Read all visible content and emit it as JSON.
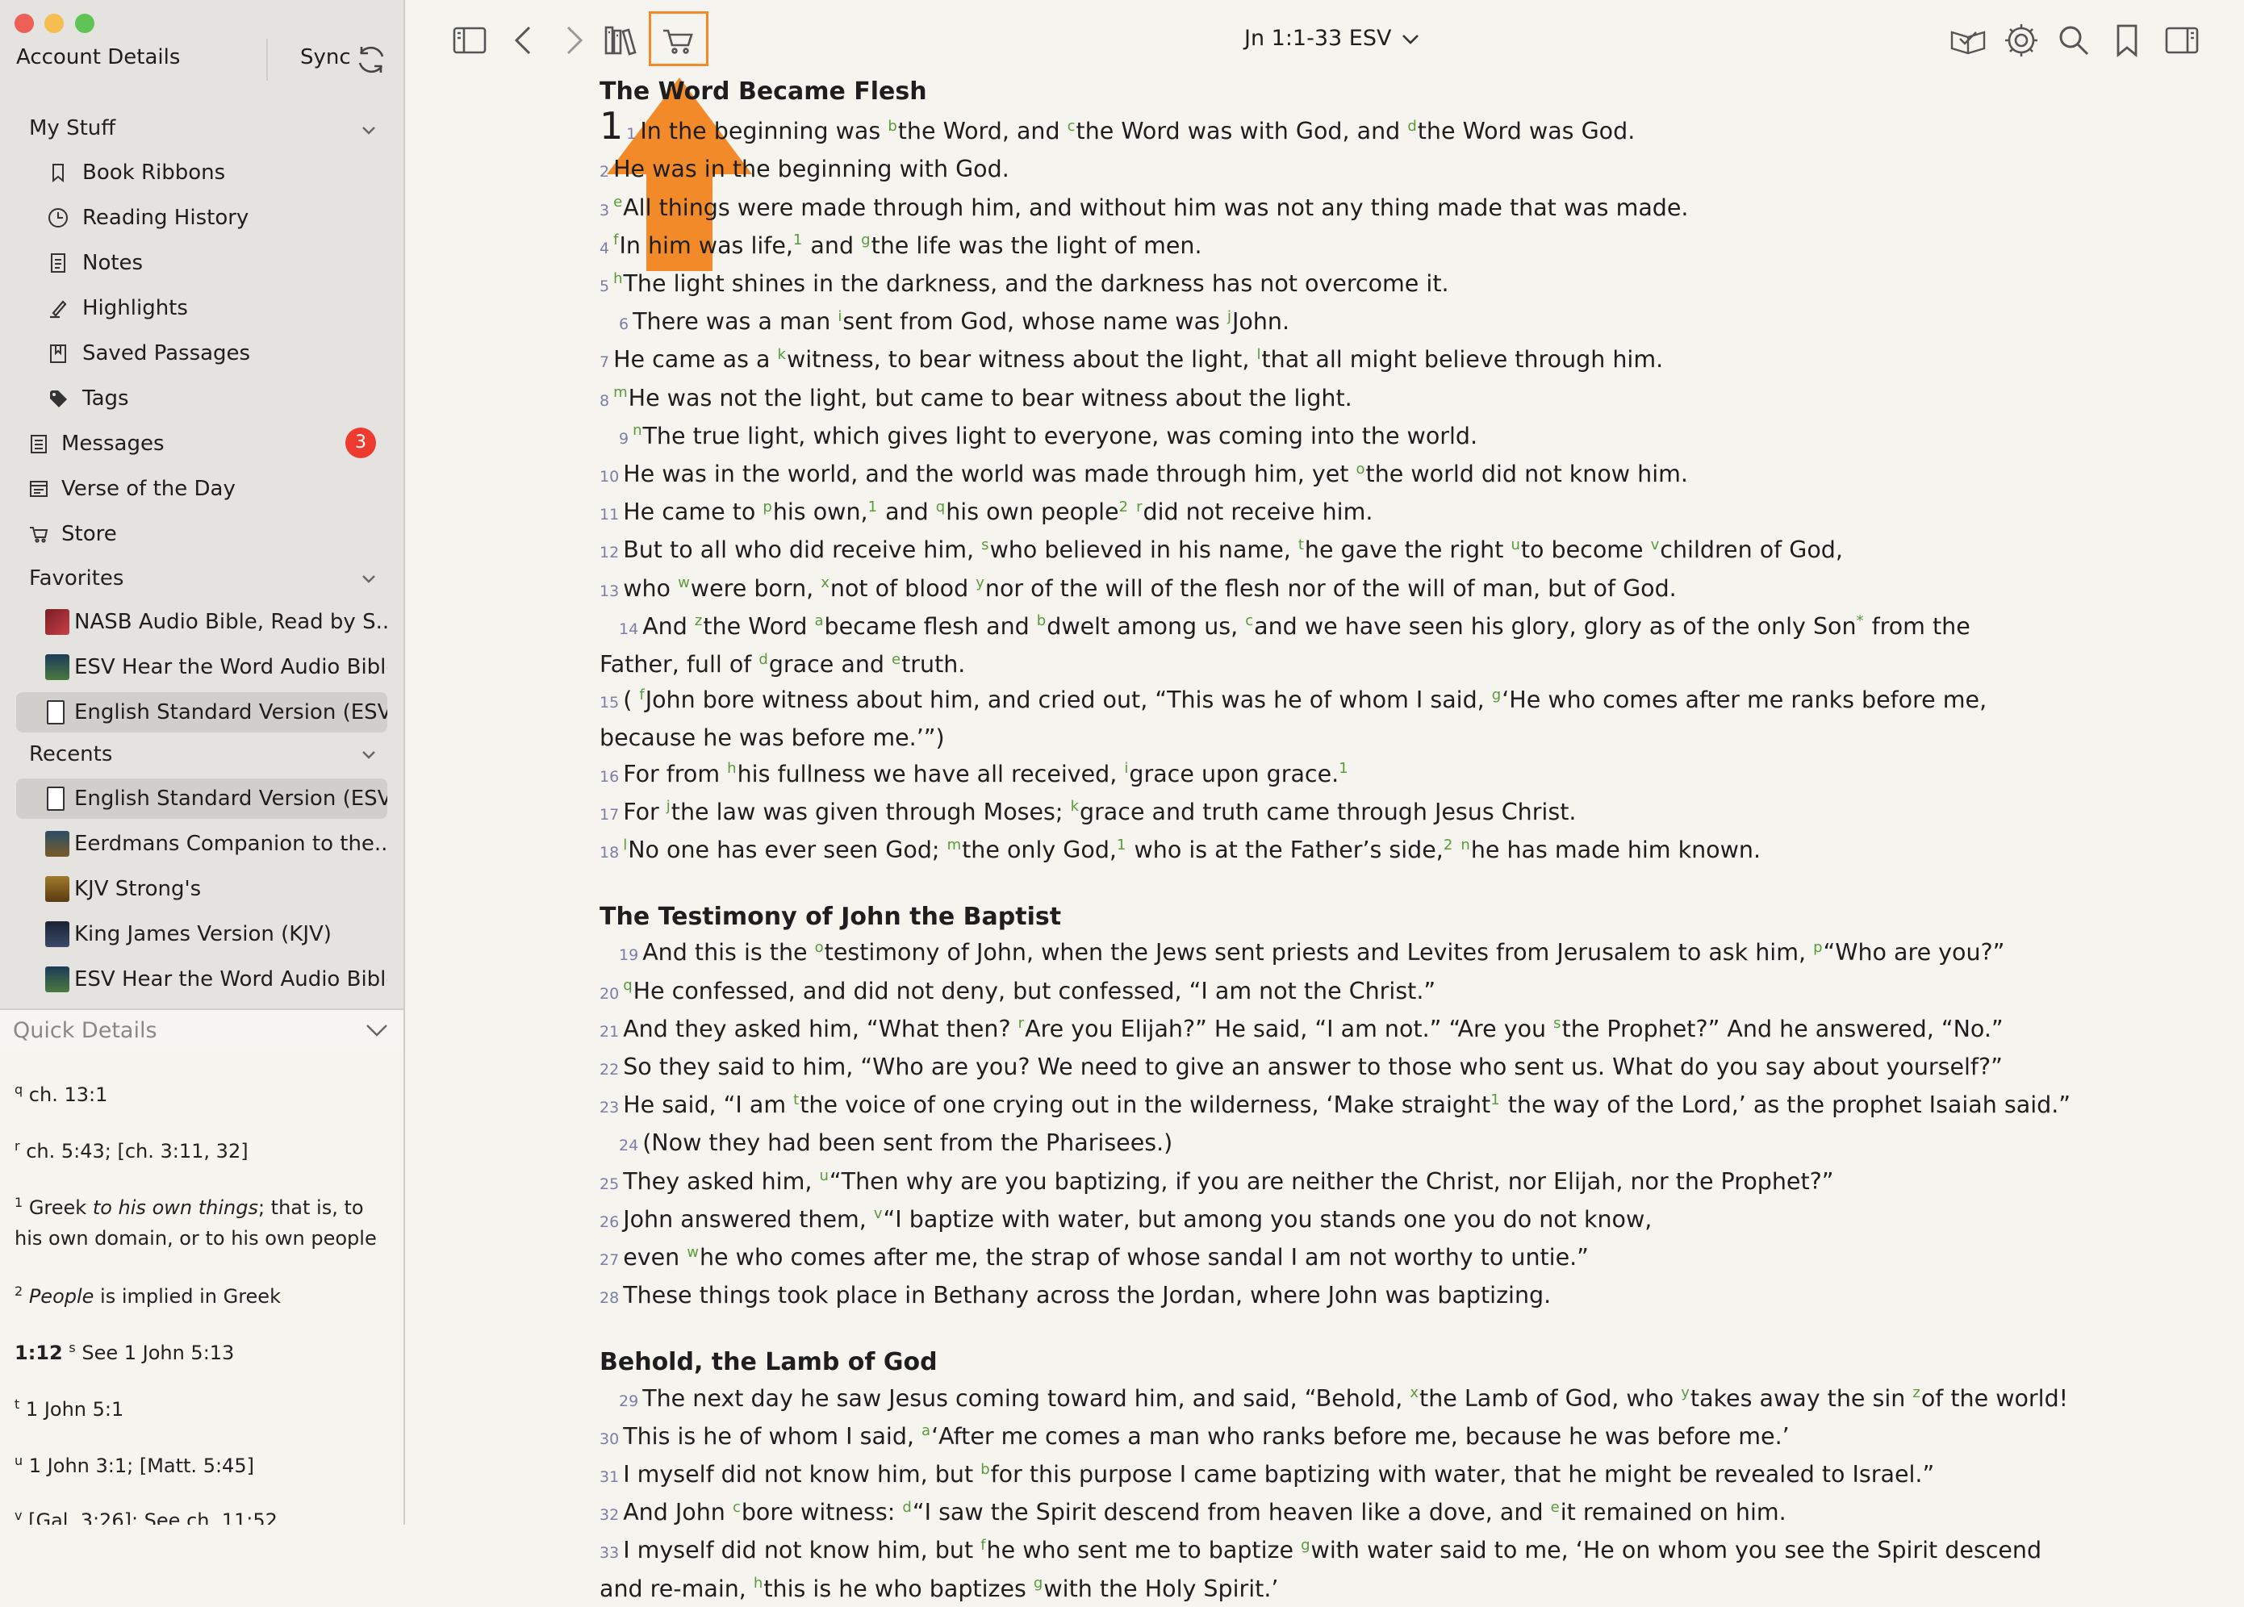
{
  "sidebar": {
    "account_details": "Account Details",
    "sync_label": "Sync",
    "sections": {
      "my_stuff": "My Stuff",
      "favorites": "Favorites",
      "recents": "Recents"
    },
    "my_stuff_items": [
      "Book Ribbons",
      "Reading History",
      "Notes",
      "Highlights",
      "Saved Passages",
      "Tags"
    ],
    "top_items": {
      "messages": "Messages",
      "verse_of_day": "Verse of the Day",
      "store": "Store"
    },
    "messages_badge": "3",
    "favorites": [
      "NASB Audio Bible, Read by S...",
      "ESV Hear the Word Audio Bible",
      "English Standard Version (ESV)"
    ],
    "recents": [
      "English Standard Version (ESV)",
      "Eerdmans Companion to the...",
      "KJV Strong's",
      "King James Version (KJV)",
      "ESV Hear the Word Audio Bible"
    ]
  },
  "quick_details": {
    "title": "Quick Details",
    "notes": [
      {
        "mark": "q",
        "text": "ch. 13:1"
      },
      {
        "mark": "r",
        "text": "ch. 5:43; [ch. 3:11, 32]"
      },
      {
        "mark": "1",
        "pre": "Greek ",
        "em": "to his own things",
        "post": "; that is, to his own domain, or to his own people"
      },
      {
        "mark": "2",
        "em": "People",
        "post": " is implied in Greek"
      },
      {
        "bold": "1:12",
        "mark": "s",
        "text": "See 1 John 5:13"
      },
      {
        "mark": "t",
        "text": "1 John 5:1"
      },
      {
        "mark": "u",
        "text": "1 John 3:1; [Matt. 5:45]"
      },
      {
        "mark": "v",
        "text": "[Gal. 3:26]; See ch. 11:52"
      }
    ]
  },
  "toolbar": {
    "reference": "Jn 1:1-33  ESV",
    "icons": [
      "sidebar-toggle-icon",
      "back-icon",
      "forward-icon",
      "library-icon",
      "cart-icon",
      "reading-plan-icon",
      "settings-icon",
      "search-icon",
      "bookmark-icon",
      "panel-icon"
    ]
  },
  "passage": {
    "headings": [
      "The Word Became Flesh",
      "The Testimony of John the Baptist",
      "Behold, the Lamb of God"
    ]
  },
  "colors": {
    "accent_orange": "#f38a2a",
    "crossref_green": "#5a9a3a",
    "verse_num": "#7b7fa8",
    "badge_red": "#ee3b30"
  }
}
